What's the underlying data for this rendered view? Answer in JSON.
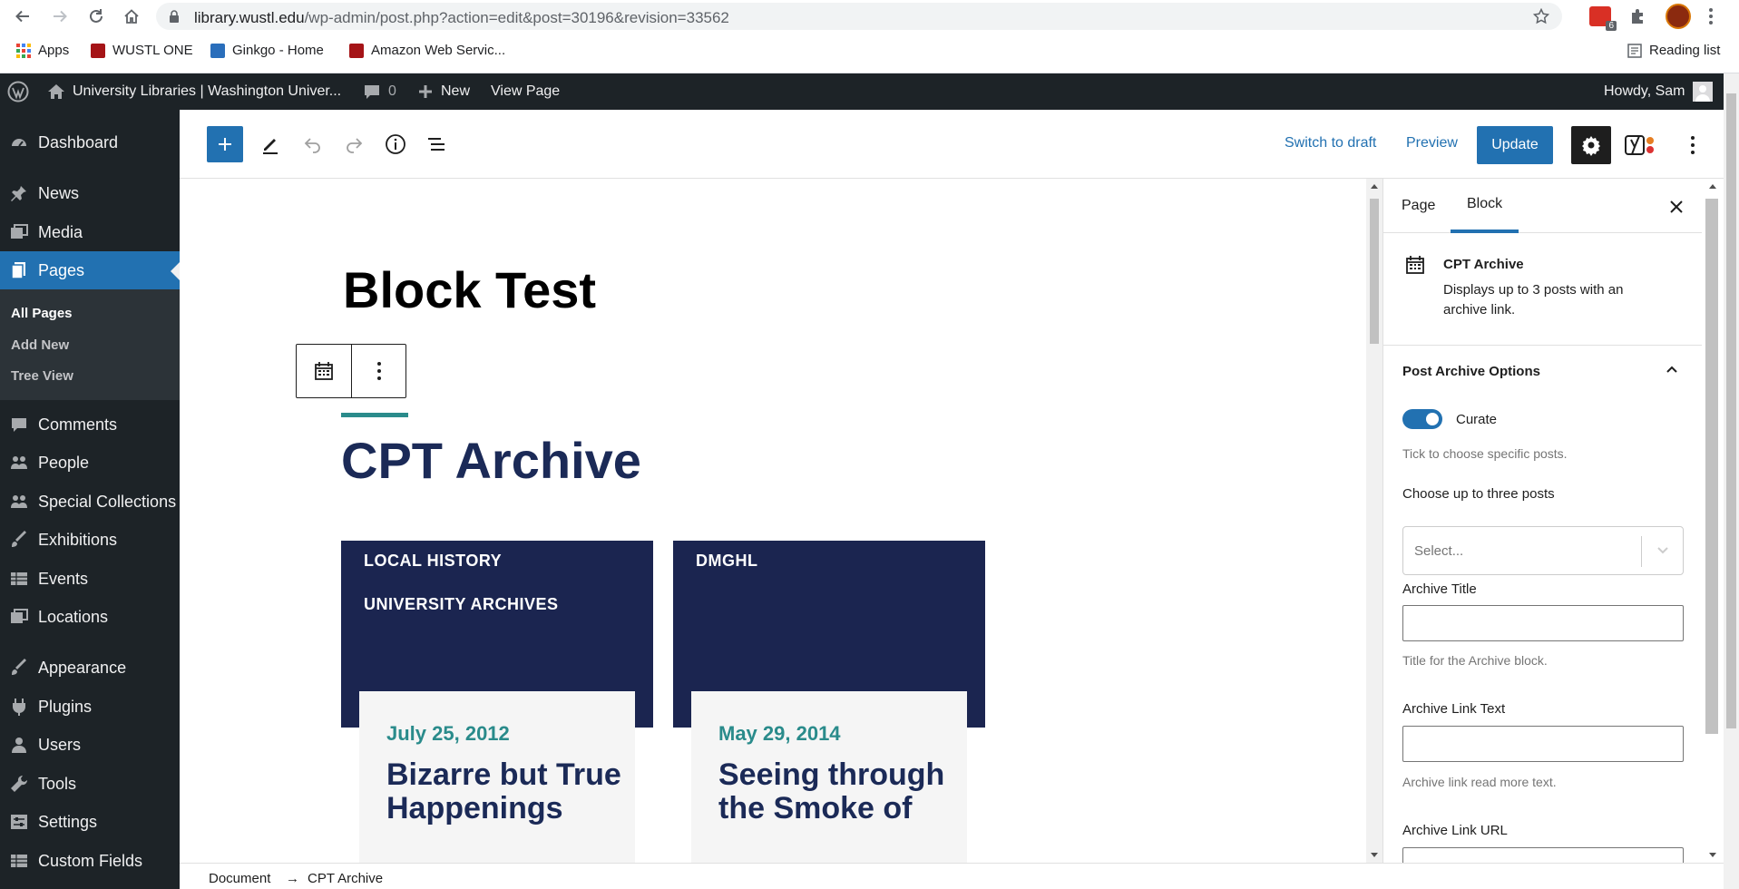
{
  "browser": {
    "url_host": "library.wustl.edu",
    "url_path": "/wp-admin/post.php?action=edit&post=30196&revision=33562",
    "extension_badge": "6",
    "bookmarks": [
      {
        "label": "Apps"
      },
      {
        "label": "WUSTL ONE"
      },
      {
        "label": "Ginkgo - Home"
      },
      {
        "label": "Amazon Web Servic..."
      }
    ],
    "reading_list": "Reading list"
  },
  "adminbar": {
    "site_name": "University Libraries | Washington Univer...",
    "comments_count": "0",
    "new_label": "New",
    "view_page": "View Page",
    "howdy": "Howdy, Sam"
  },
  "sidebar": {
    "items": [
      {
        "label": "Dashboard"
      },
      {
        "label": "News"
      },
      {
        "label": "Media"
      },
      {
        "label": "Pages"
      },
      {
        "label": "Comments"
      },
      {
        "label": "People"
      },
      {
        "label": "Special Collections"
      },
      {
        "label": "Exhibitions"
      },
      {
        "label": "Events"
      },
      {
        "label": "Locations"
      },
      {
        "label": "Appearance"
      },
      {
        "label": "Plugins"
      },
      {
        "label": "Users"
      },
      {
        "label": "Tools"
      },
      {
        "label": "Settings"
      },
      {
        "label": "Custom Fields"
      }
    ],
    "submenu": [
      {
        "label": "All Pages"
      },
      {
        "label": "Add New"
      },
      {
        "label": "Tree View"
      }
    ]
  },
  "header": {
    "switch_to_draft": "Switch to draft",
    "preview": "Preview",
    "update": "Update"
  },
  "canvas": {
    "page_title": "Block Test",
    "archive_title": "CPT Archive",
    "cards": [
      {
        "tags": [
          "LOCAL HISTORY",
          "UNIVERSITY ARCHIVES"
        ],
        "date": "July 25, 2012",
        "title": "Bizarre but True Happenings"
      },
      {
        "tags": [
          "DMGHL"
        ],
        "date": "May 29, 2014",
        "title": "Seeing through the Smoke of"
      }
    ]
  },
  "settings": {
    "tab_page": "Page",
    "tab_block": "Block",
    "block_name": "CPT Archive",
    "block_desc": "Displays up to 3 posts with an archive link.",
    "panel_title": "Post Archive Options",
    "curate_label": "Curate",
    "curate_enabled": true,
    "curate_help": "Tick to choose specific posts.",
    "choose_label": "Choose up to three posts",
    "select_placeholder": "Select...",
    "archive_title_label": "Archive Title",
    "archive_title_value": "",
    "archive_title_help": "Title for the Archive block.",
    "archive_link_text_label": "Archive Link Text",
    "archive_link_text_value": "",
    "archive_link_text_help": "Archive link read more text.",
    "archive_link_url_label": "Archive Link URL"
  },
  "footer": {
    "crumb_document": "Document",
    "crumb_sep": "→",
    "crumb_block": "CPT Archive"
  },
  "colors": {
    "wp_blue": "#2271b1",
    "admin_dark": "#1d2327",
    "archive_navy": "#1b2550",
    "accent_teal": "#2a8b8b"
  }
}
